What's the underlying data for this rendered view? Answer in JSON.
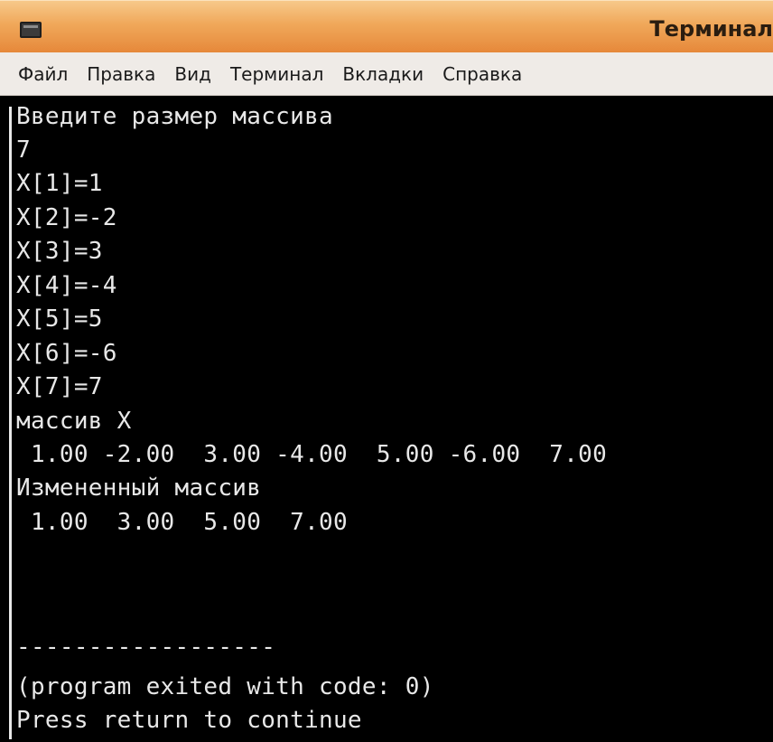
{
  "window": {
    "title": "Терминал"
  },
  "menu": [
    "Файл",
    "Правка",
    "Вид",
    "Терминал",
    "Вкладки",
    "Справка"
  ],
  "terminal": {
    "lines": [
      "Введите размер массива",
      "7",
      "X[1]=1",
      "X[2]=-2",
      "X[3]=3",
      "X[4]=-4",
      "X[5]=5",
      "X[6]=-6",
      "X[7]=7",
      "массив X",
      " 1.00 -2.00  3.00 -4.00  5.00 -6.00  7.00",
      "Измененный массив",
      " 1.00  3.00  5.00  7.00",
      "",
      "",
      "------------------",
      "(program exited with code: 0)",
      "Press return to continue"
    ]
  },
  "colors": {
    "titlebar": "#f0a85a",
    "menubar": "#efebe7",
    "terminal_bg": "#000000",
    "terminal_fg": "#e8e8e8"
  }
}
